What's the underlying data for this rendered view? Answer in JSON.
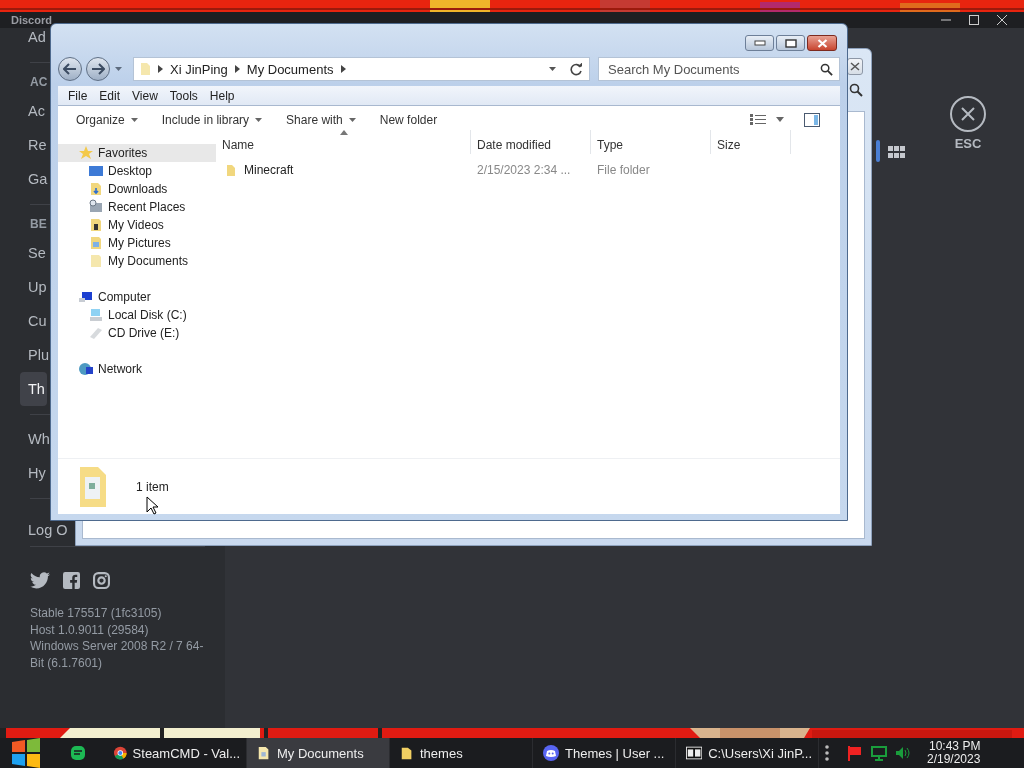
{
  "discord": {
    "title": "Discord",
    "sections": [
      {
        "items": [
          {
            "label": "Ad",
            "selected": false
          }
        ]
      },
      {
        "header": "AC",
        "items": [
          {
            "label": "Ac",
            "selected": false
          },
          {
            "label": "Re",
            "selected": false
          },
          {
            "label": "Ga",
            "selected": false
          }
        ]
      },
      {
        "header": "BE",
        "items": [
          {
            "label": "Se",
            "selected": false
          },
          {
            "label": "Up",
            "selected": false
          },
          {
            "label": "Cu",
            "selected": false
          },
          {
            "label": "Plu",
            "selected": false
          },
          {
            "label": "Th",
            "selected": true
          }
        ]
      },
      {
        "items": [
          {
            "label": "Wh",
            "selected": false
          },
          {
            "label": "Hy",
            "selected": false
          }
        ]
      },
      {
        "items": [
          {
            "label": "Log O",
            "selected": false
          }
        ]
      }
    ],
    "version_lines": [
      "Stable 175517 (1fc3105)",
      "Host 1.0.9011 (29584)",
      "Windows Server 2008 R2 / 7 64-Bit (6.1.7601)"
    ],
    "close_label": "ESC"
  },
  "explorer": {
    "breadcrumb": [
      "Xi JinPing",
      "My Documents"
    ],
    "search": {
      "placeholder": "Search My Documents"
    },
    "menu": [
      "File",
      "Edit",
      "View",
      "Tools",
      "Help"
    ],
    "toolbar": [
      {
        "label": "Organize",
        "dropdown": true
      },
      {
        "label": "Include in library",
        "dropdown": true
      },
      {
        "label": "Share with",
        "dropdown": true
      },
      {
        "label": "New folder",
        "dropdown": false
      }
    ],
    "nav": [
      {
        "label": "Favorites",
        "kind": "star",
        "selected": true,
        "children": [
          {
            "label": "Desktop",
            "kind": "desktop",
            "selected": false
          },
          {
            "label": "Downloads",
            "kind": "downloads",
            "selected": false
          },
          {
            "label": "Recent Places",
            "kind": "recent",
            "selected": false
          },
          {
            "label": "My Videos",
            "kind": "videos",
            "selected": false
          },
          {
            "label": "My Pictures",
            "kind": "pictures",
            "selected": false
          },
          {
            "label": "My Documents",
            "kind": "documents",
            "selected": false
          }
        ]
      },
      {
        "label": "Computer",
        "kind": "computer",
        "selected": false,
        "children": [
          {
            "label": "Local Disk (C:)",
            "kind": "disk",
            "selected": false
          },
          {
            "label": "CD Drive (E:)",
            "kind": "cd",
            "selected": false
          }
        ]
      },
      {
        "label": "Network",
        "kind": "network",
        "selected": false
      }
    ],
    "columns": [
      {
        "label": "Name",
        "sorted": true
      },
      {
        "label": "Date modified",
        "sorted": false
      },
      {
        "label": "Type",
        "sorted": false
      },
      {
        "label": "Size",
        "sorted": false
      }
    ],
    "rows": [
      {
        "name": "Minecraft",
        "date": "2/15/2023 2:34 ...",
        "type": "File folder"
      }
    ],
    "status": "1 item"
  },
  "taskbar": {
    "items": [
      {
        "kind": "chrome",
        "label": "SteamCMD - Val...",
        "selected": false
      },
      {
        "kind": "document",
        "label": "My Documents",
        "selected": true
      },
      {
        "kind": "folder",
        "label": "themes",
        "selected": false
      },
      {
        "kind": "discord",
        "label": "Themes | User ...",
        "selected": false
      },
      {
        "kind": "archive",
        "label": "C:\\Users\\Xi JinP...",
        "selected": false
      }
    ],
    "time": "10:43 PM",
    "date": "2/19/2023"
  }
}
